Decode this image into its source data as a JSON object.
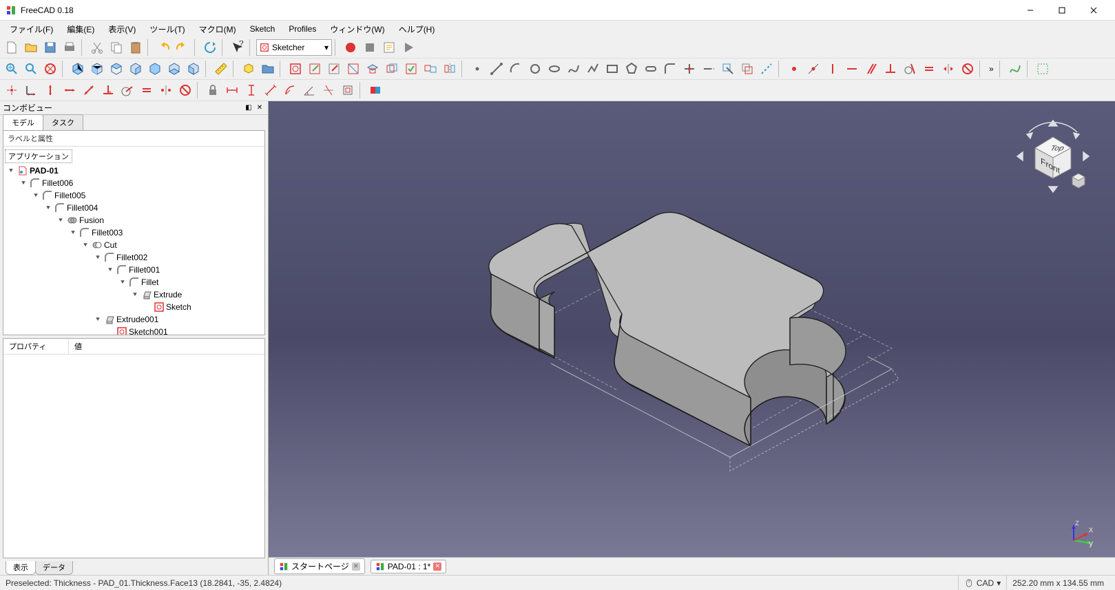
{
  "window": {
    "title": "FreeCAD 0.18"
  },
  "menu": {
    "items": [
      "ファイル(F)",
      "編集(E)",
      "表示(V)",
      "ツール(T)",
      "マクロ(M)",
      "Sketch",
      "Profiles",
      "ウィンドウ(W)",
      "ヘルプ(H)"
    ]
  },
  "workbench": {
    "selected": "Sketcher"
  },
  "combo": {
    "title": "コンボビュー",
    "tabs": {
      "model": "モデル",
      "task": "タスク"
    },
    "tree_header": "ラベルと属性",
    "application": "アプリケーション",
    "doc": "PAD-01",
    "nodes": [
      {
        "indent": 1,
        "label": "Fillet006",
        "icon": "fillet"
      },
      {
        "indent": 2,
        "label": "Fillet005",
        "icon": "fillet"
      },
      {
        "indent": 3,
        "label": "Fillet004",
        "icon": "fillet"
      },
      {
        "indent": 4,
        "label": "Fusion",
        "icon": "fusion"
      },
      {
        "indent": 5,
        "label": "Fillet003",
        "icon": "fillet"
      },
      {
        "indent": 6,
        "label": "Cut",
        "icon": "cut"
      },
      {
        "indent": 7,
        "label": "Fillet002",
        "icon": "fillet"
      },
      {
        "indent": 8,
        "label": "Fillet001",
        "icon": "fillet"
      },
      {
        "indent": 9,
        "label": "Fillet",
        "icon": "fillet"
      },
      {
        "indent": 10,
        "label": "Extrude",
        "icon": "extrude"
      },
      {
        "indent": 11,
        "label": "Sketch",
        "icon": "sketch",
        "notw": true
      },
      {
        "indent": 7,
        "label": "Extrude001",
        "icon": "extrude"
      },
      {
        "indent": 8,
        "label": "Sketch001",
        "icon": "sketch",
        "notw": true
      }
    ],
    "prop_header": {
      "property": "プロパティ",
      "value": "値"
    },
    "bottom_tabs": {
      "view": "表示",
      "data": "データ"
    }
  },
  "doctabs": [
    {
      "label": "スタートページ",
      "close": "grey"
    },
    {
      "label": "PAD-01 : 1*",
      "close": "red"
    }
  ],
  "status": {
    "preselect": "Preselected: Thickness - PAD_01.Thickness.Face13 (18.2841, -35, 2.4824)",
    "mode": "CAD",
    "dims": "252.20 mm x 134.55 mm"
  },
  "navcube": {
    "top": "Top",
    "front": "Front"
  }
}
